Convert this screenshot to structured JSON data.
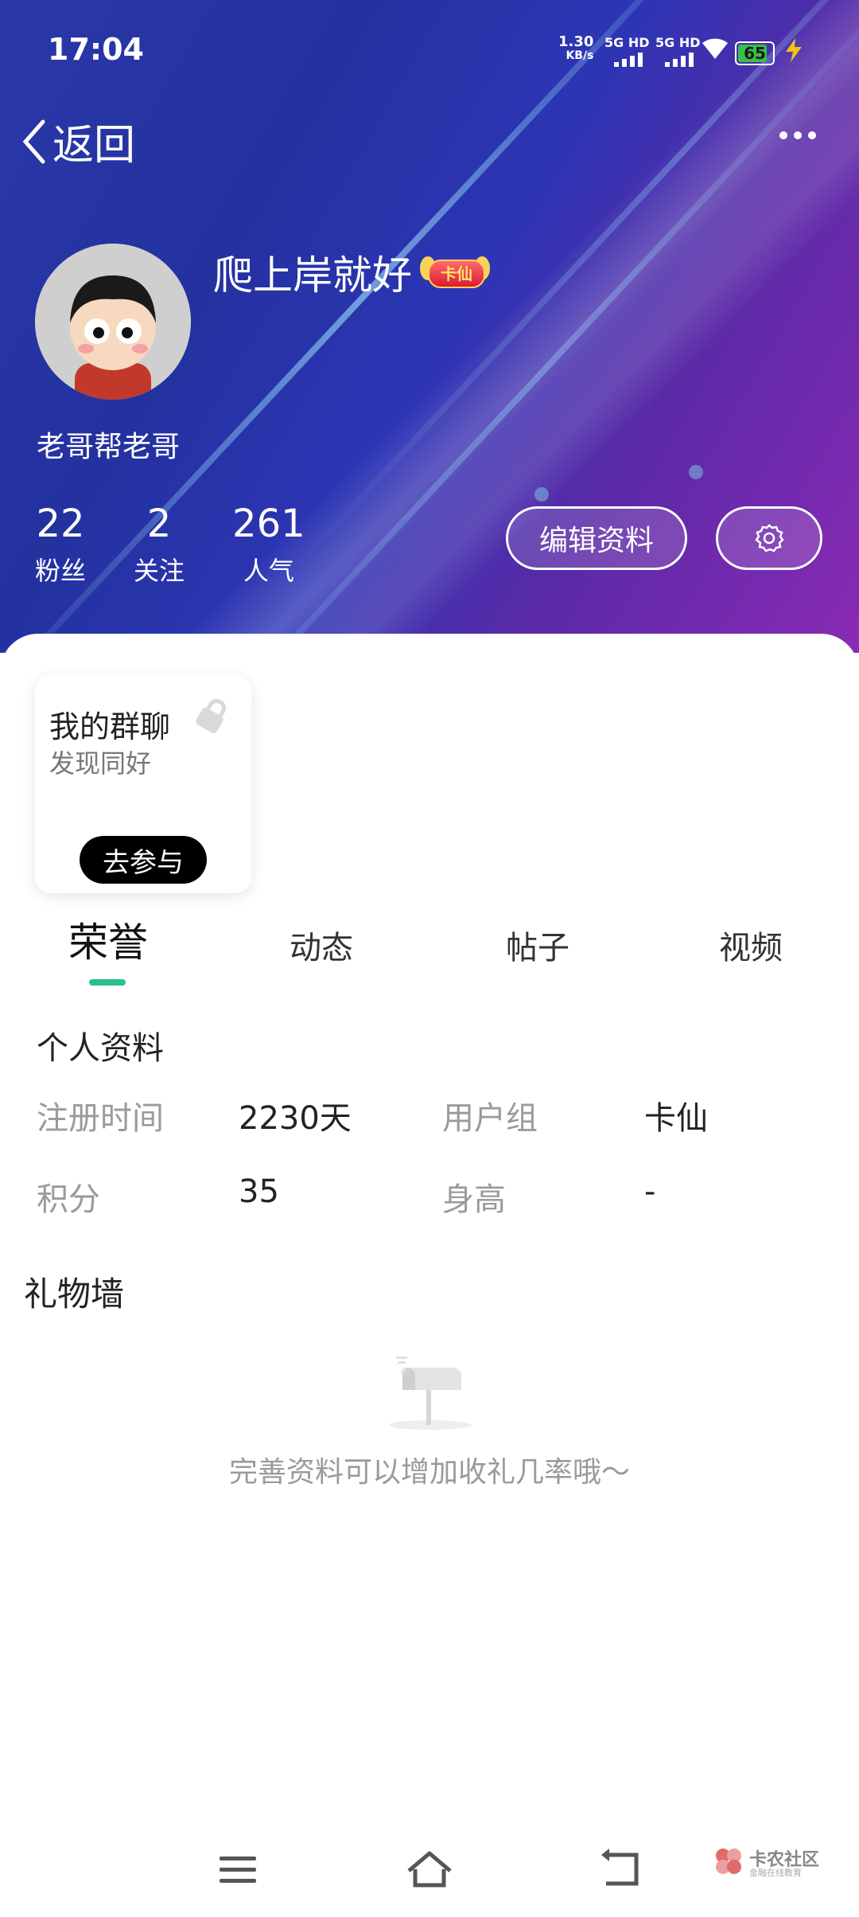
{
  "status_bar": {
    "time": "17:04",
    "net_speed_value": "1.30",
    "net_speed_unit": "KB/s",
    "sim1": "5G HD",
    "sim2": "5G HD",
    "battery": "65",
    "battery_color": "#35c24a"
  },
  "nav": {
    "back_label": "返回"
  },
  "profile": {
    "username": "爬上岸就好",
    "badge": "卡仙",
    "bio": "老哥帮老哥",
    "stats": [
      {
        "value": "22",
        "label": "粉丝"
      },
      {
        "value": "2",
        "label": "关注"
      },
      {
        "value": "261",
        "label": "人气"
      }
    ],
    "edit_button": "编辑资料"
  },
  "group_chat": {
    "title": "我的群聊",
    "subtitle": "发现同好",
    "join_button": "去参与"
  },
  "tabs": [
    {
      "label": "荣誉",
      "active": true
    },
    {
      "label": "动态",
      "active": false
    },
    {
      "label": "帖子",
      "active": false
    },
    {
      "label": "视频",
      "active": false
    }
  ],
  "accent_color": "#2bbf94",
  "personal_info": {
    "title": "个人资料",
    "rows": [
      {
        "l1": "注册时间",
        "v1": "2230天",
        "l2": "用户组",
        "v2": "卡仙"
      },
      {
        "l1": "积分",
        "v1": "35",
        "l2": "身高",
        "v2": "-"
      }
    ]
  },
  "gift_wall": {
    "title": "礼物墙",
    "empty_text": "完善资料可以增加收礼几率哦～"
  },
  "watermark": {
    "name": "卡农社区",
    "tagline": "金融在线教育"
  },
  "icons": {
    "back": "chevron-left-icon",
    "more": "more-dots-icon",
    "settings": "gear-icon",
    "lock": "lock-icon",
    "mailbox": "mailbox-icon",
    "menu": "menu-icon",
    "home": "home-icon",
    "return": "return-icon"
  }
}
